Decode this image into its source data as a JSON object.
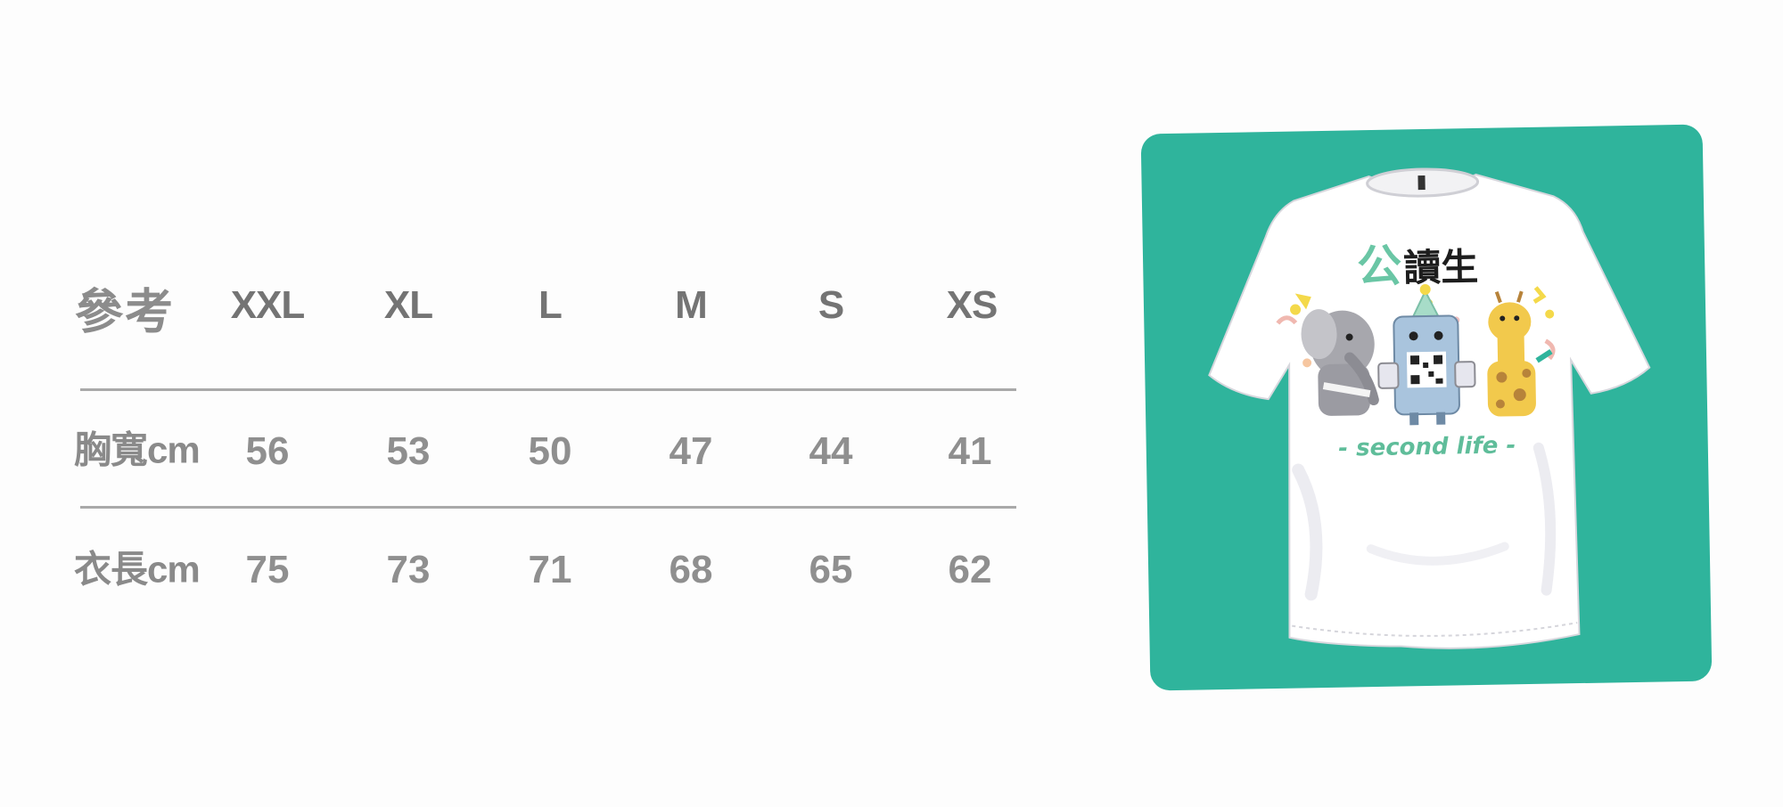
{
  "size_table": {
    "corner_label": "參考",
    "sizes": [
      "XXL",
      "XL",
      "L",
      "M",
      "S",
      "XS"
    ],
    "rows": [
      {
        "label": "胸寬cm",
        "values": [
          "56",
          "53",
          "50",
          "47",
          "44",
          "41"
        ]
      },
      {
        "label": "衣長cm",
        "values": [
          "75",
          "73",
          "71",
          "68",
          "65",
          "62"
        ]
      }
    ]
  },
  "product_image": {
    "background_color": "#2fb49c",
    "shirt_color": "#ffffff",
    "brand_accent_char": "公",
    "brand_rest": "讀生",
    "slogan": "- second life -"
  }
}
